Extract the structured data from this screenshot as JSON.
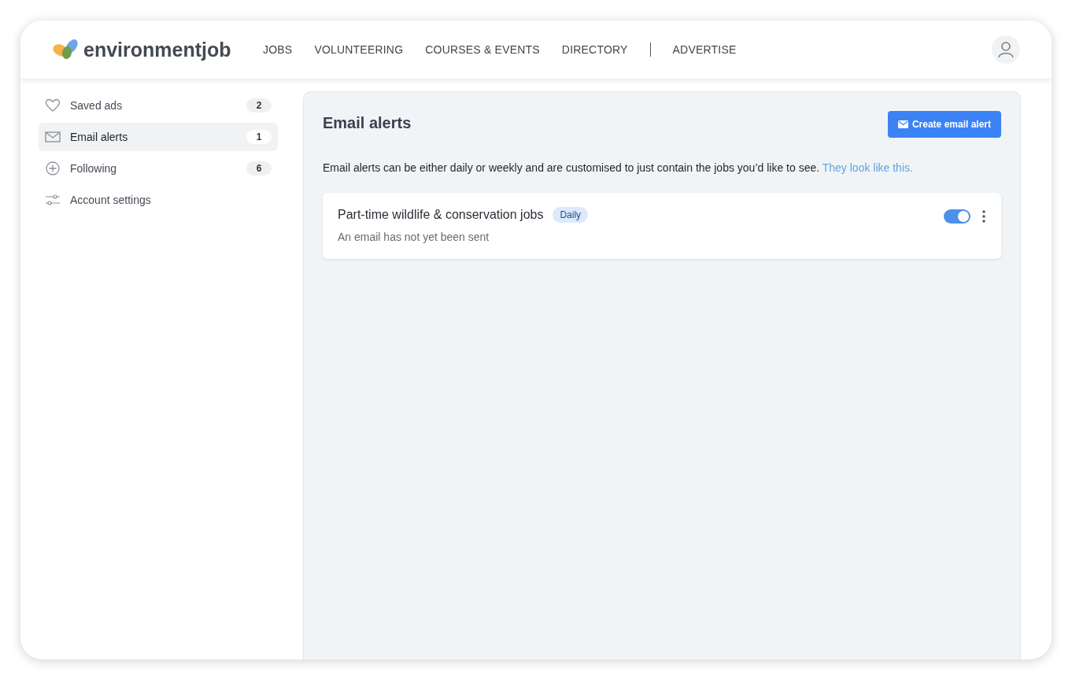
{
  "header": {
    "logo": "environmentjob",
    "nav": [
      "JOBS",
      "VOLUNTEERING",
      "COURSES & EVENTS",
      "DIRECTORY"
    ],
    "nav_secondary": [
      "ADVERTISE"
    ]
  },
  "sidebar": {
    "items": [
      {
        "kind": "heart",
        "label": "Saved ads",
        "count": "2",
        "selected": false
      },
      {
        "kind": "mail",
        "label": "Email alerts",
        "count": "1",
        "selected": true
      },
      {
        "kind": "plus",
        "label": "Following",
        "count": "6",
        "selected": false
      },
      {
        "kind": "sliders",
        "label": "Account settings",
        "selected": false
      }
    ]
  },
  "main": {
    "title": "Email alerts",
    "create_button": "Create email alert",
    "intro": "Email alerts can be either daily or weekly and are customised to just contain the jobs you’d like to see.",
    "intro_link": "They look like this.",
    "alerts": [
      {
        "title": "Part-time wildlife & conservation jobs",
        "frequency": "Daily",
        "status": "An email has not yet been sent",
        "on": true
      }
    ]
  }
}
